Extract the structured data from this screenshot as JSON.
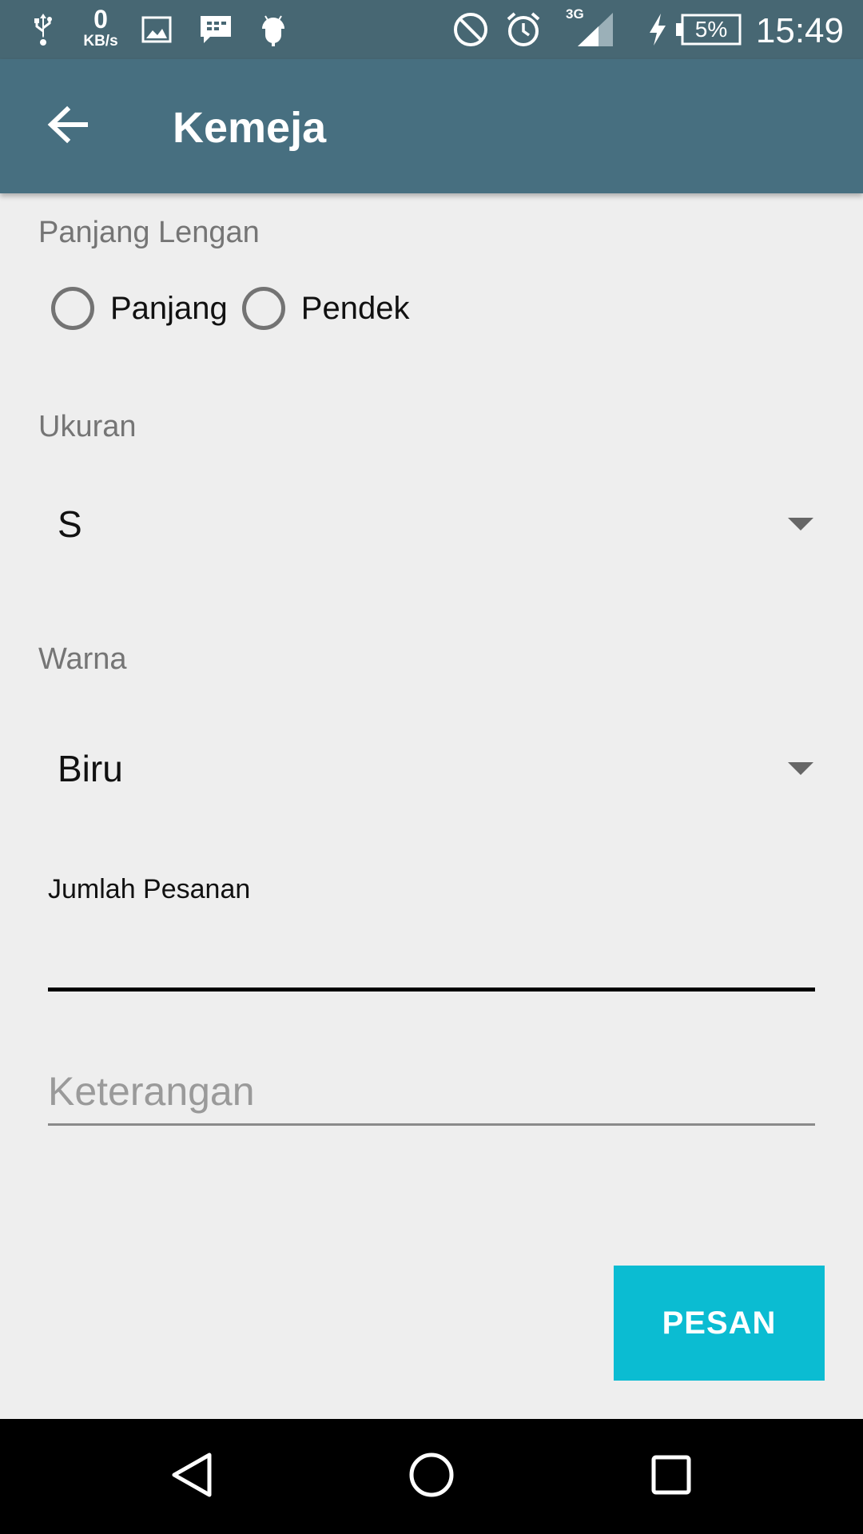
{
  "status_bar": {
    "net_speed_value": "0",
    "net_speed_unit": "KB/s",
    "network_type": "3G",
    "battery_percent": "5%",
    "time": "15:49",
    "icons": [
      "usb-icon",
      "image-icon",
      "bbm-icon",
      "android-icon",
      "do-not-disturb-icon",
      "alarm-icon",
      "signal-icon",
      "charging-icon",
      "battery-icon"
    ]
  },
  "app_bar": {
    "title": "Kemeja",
    "back_icon": "arrow-back-icon"
  },
  "form": {
    "sleeve": {
      "label": "Panjang Lengan",
      "options": [
        "Panjang",
        "Pendek"
      ],
      "selected": null
    },
    "size": {
      "label": "Ukuran",
      "selected": "S"
    },
    "color": {
      "label": "Warna",
      "selected": "Biru"
    },
    "quantity": {
      "label": "Jumlah Pesanan",
      "value": ""
    },
    "note": {
      "placeholder": "Keterangan",
      "value": ""
    },
    "submit_label": "PESAN"
  },
  "colors": {
    "status_bar": "#476773",
    "app_bar": "#476f80",
    "accent_button": "#0bbcd2",
    "background": "#eeeeee"
  }
}
